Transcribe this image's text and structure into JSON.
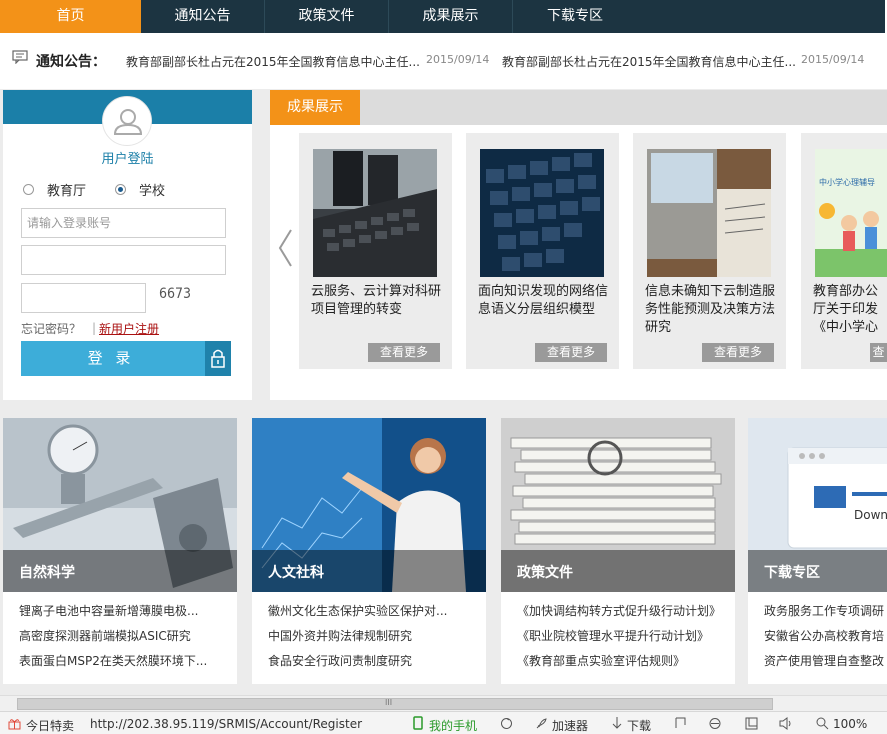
{
  "nav": {
    "items": [
      "首页",
      "通知公告",
      "政策文件",
      "成果展示",
      "下载专区"
    ]
  },
  "notice": {
    "label": "通知公告：",
    "items": [
      {
        "text": "教育部副部长杜占元在2015年全国教育信息中心主任...",
        "date": "2015/09/14"
      },
      {
        "text": "教育部副部长杜占元在2015年全国教育信息中心主任...",
        "date": "2015/09/14"
      }
    ]
  },
  "login": {
    "title": "用户登陆",
    "radio_options": [
      "教育厅",
      "学校"
    ],
    "selected": "学校",
    "account_placeholder": "请输入登录账号",
    "captcha": "6673",
    "forgot": "忘记密码？",
    "separator": "|",
    "register": "新用户注册",
    "submit": "登 录"
  },
  "results": {
    "tab": "成果展示",
    "cards": [
      {
        "title": "云服务、云计算对科研项目管理的转变",
        "more": "查看更多"
      },
      {
        "title": "面向知识发现的网络信息语义分层组织模型",
        "more": "查看更多"
      },
      {
        "title": "信息未确知下云制造服务性能预测及决策方法研究",
        "more": "查看更多"
      },
      {
        "title": "教育部办公厅关于印发《中小学心理辅导室建设指南》",
        "more": "查看更多"
      }
    ],
    "card4_pic_text": "中小学心理辅导"
  },
  "categories": [
    {
      "name": "自然科学",
      "items": [
        "锂离子电池中容量新增薄膜电极...",
        "高密度探测器前端模拟ASIC研究",
        "表面蛋白MSP2在类天然膜环境下..."
      ]
    },
    {
      "name": "人文社科",
      "items": [
        "徽州文化生态保护实验区保护对...",
        "中国外资并购法律规制研究",
        "食品安全行政问责制度研究"
      ]
    },
    {
      "name": "政策文件",
      "items": [
        "《加快调结构转方式促升级行动计划》",
        "《职业院校管理水平提升行动计划》",
        "《教育部重点实验室评估规则》"
      ]
    },
    {
      "name": "下载专区",
      "items": [
        "政务服务工作专项调研",
        "安徽省公办高校教育培",
        "资产使用管理自查整改"
      ]
    }
  ],
  "download_pic_text": "Down",
  "statusbar": {
    "today": "今日特卖",
    "url": "http://202.38.95.119/SRMIS/Account/Register",
    "phone": "我的手机",
    "accelerator": "加速器",
    "download": "下载",
    "zoom": "100%",
    "scroll_grip": "III"
  }
}
